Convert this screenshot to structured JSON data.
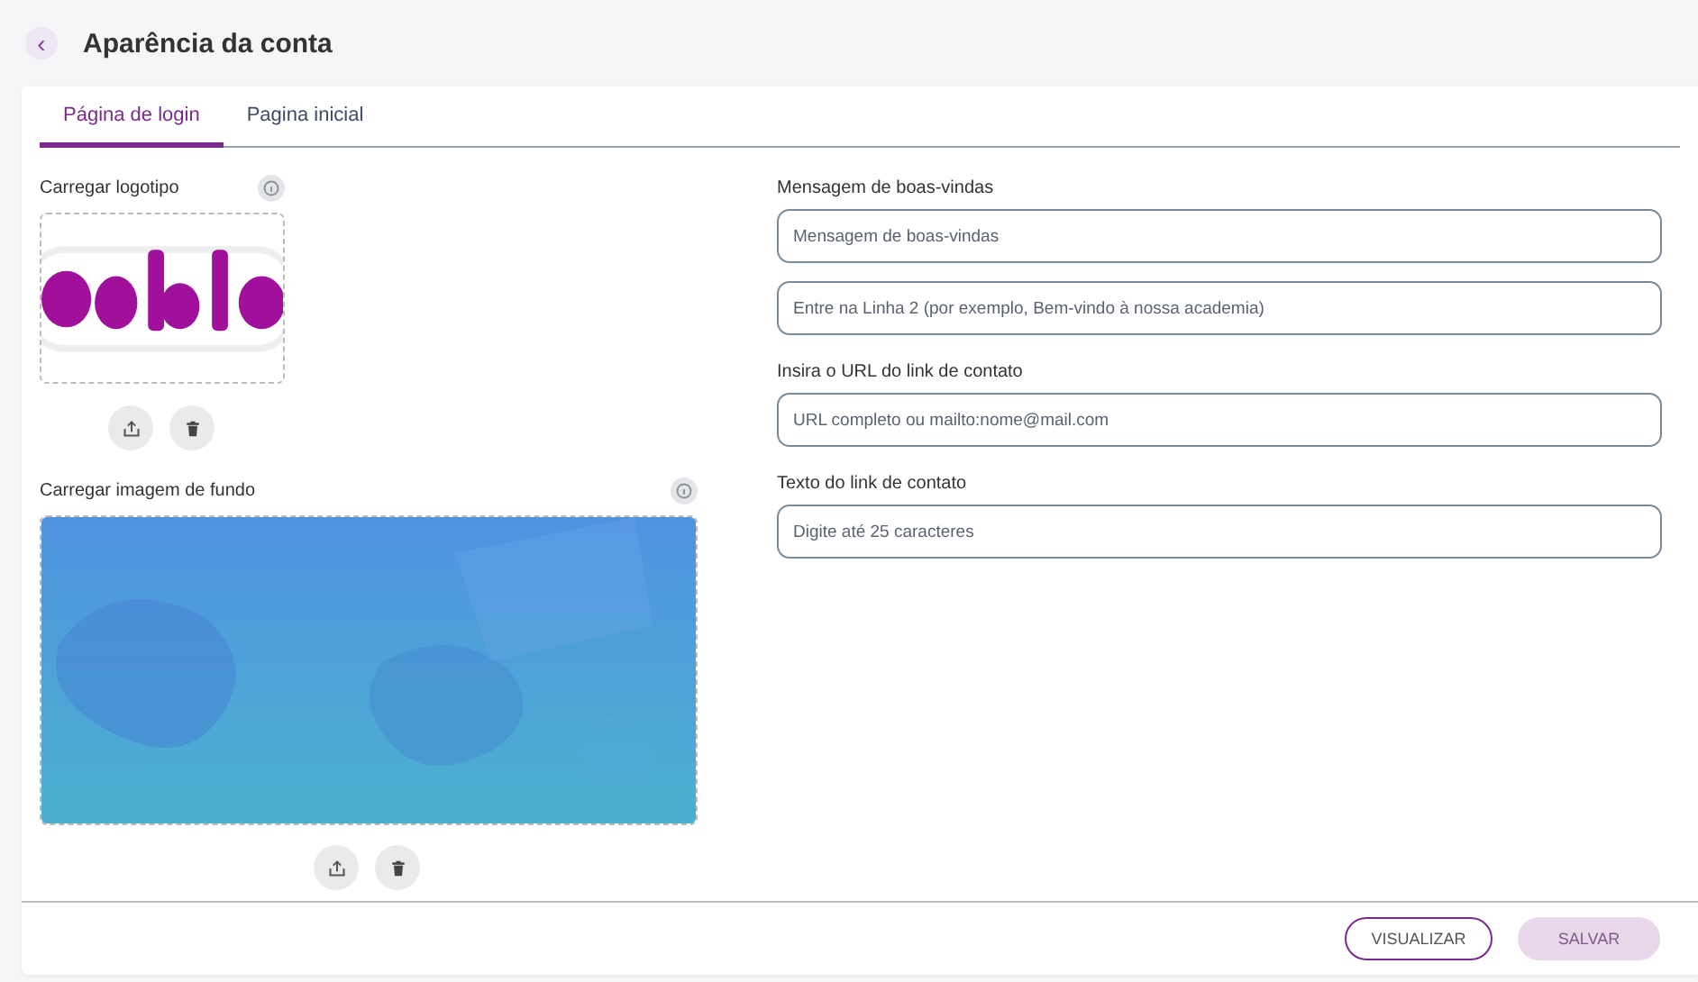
{
  "header": {
    "back_icon": "‹",
    "title": "Aparência da conta"
  },
  "tabs": [
    {
      "label": "Página de login",
      "selected": true
    },
    {
      "label": "Pagina inicial",
      "selected": false
    }
  ],
  "uploads": [
    {
      "label": "Carregar logotipo",
      "kind": "logo"
    },
    {
      "label": "Carregar imagem de fundo",
      "kind": "background"
    }
  ],
  "fields": [
    {
      "label": "Mensagem de boas-vindas",
      "placeholder": "Mensagem de boas-vindas"
    },
    {
      "placeholder": "Entre na Linha 2 (por exemplo, Bem-vindo à nossa academia)"
    },
    {
      "label": "Insira o URL do link de contato",
      "placeholder": "URL completo ou mailto:nome@mail.com"
    },
    {
      "label": "Texto do link de contato",
      "placeholder": "Digite até 25 caracteres"
    }
  ],
  "buttons": [
    {
      "label": "VISUALIZAR",
      "disabled": false
    },
    {
      "label": "SALVAR",
      "disabled": true
    }
  ]
}
